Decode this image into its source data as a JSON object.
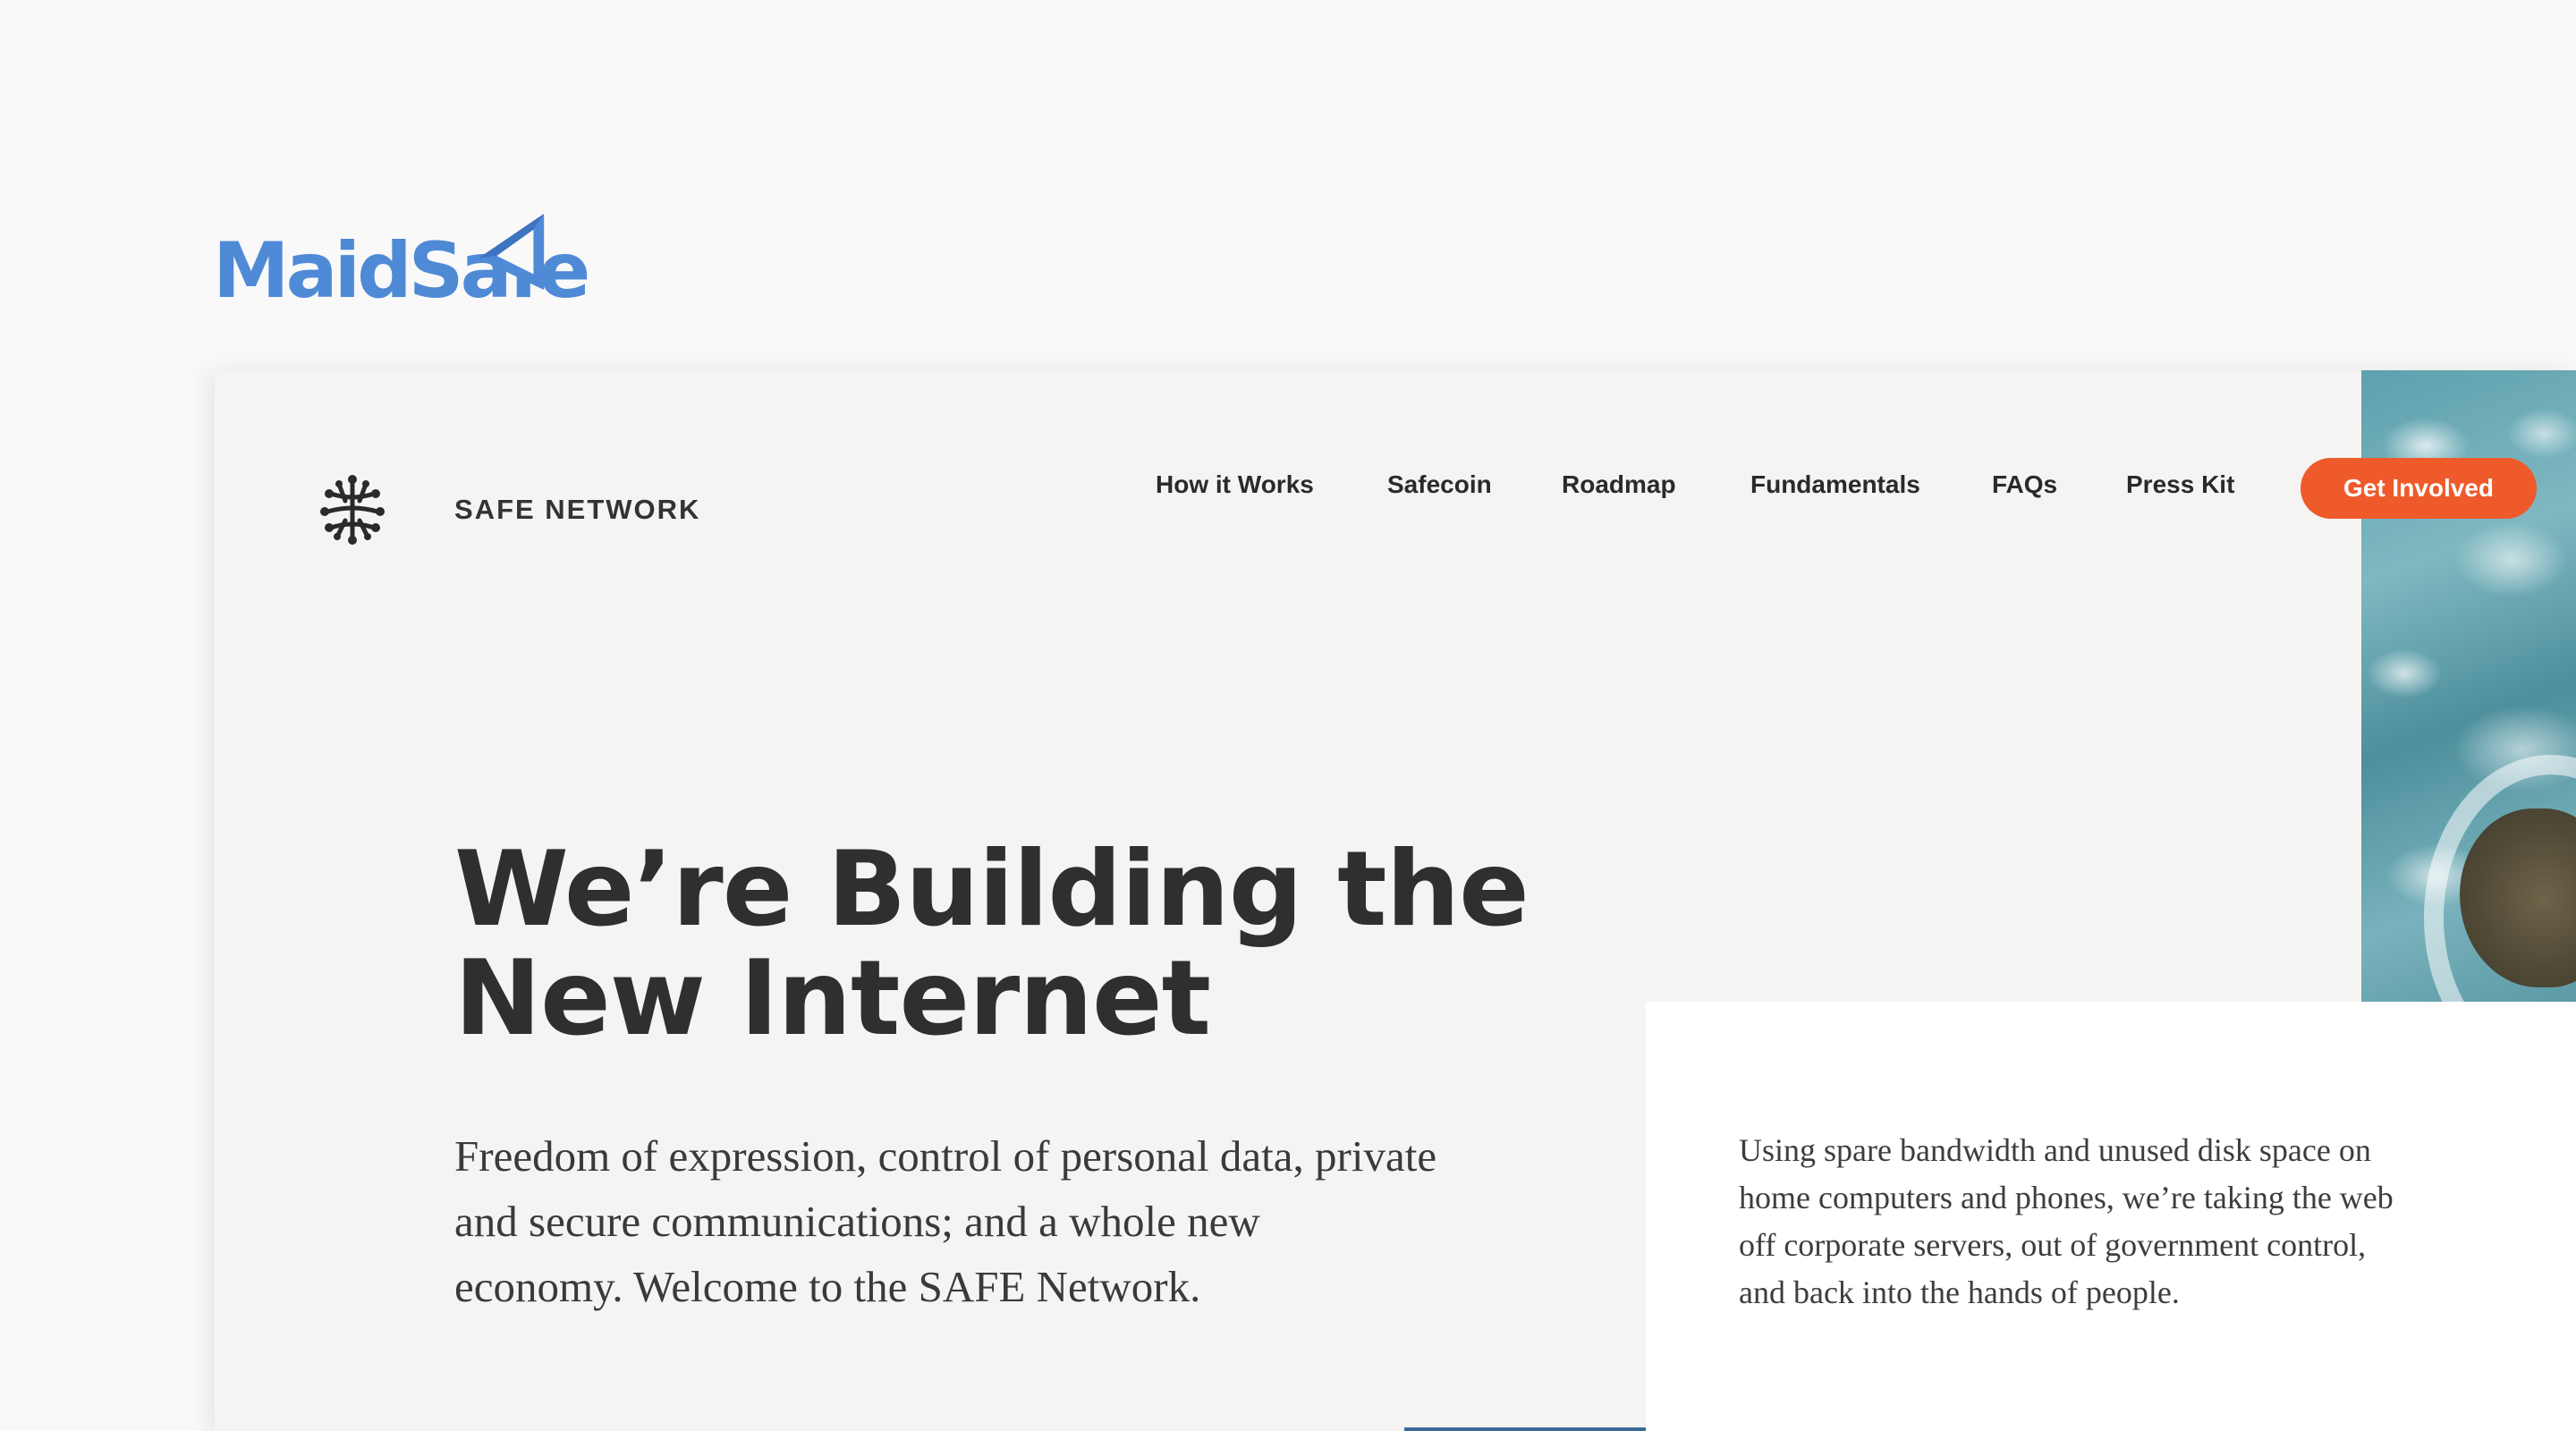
{
  "brand": {
    "name": "MaidSafe",
    "color": "#4f8ad6"
  },
  "site": {
    "logo_text": "SAFE NETWORK",
    "logo_icon": "network-neuron-icon",
    "nav": [
      "How it Works",
      "Safecoin",
      "Roadmap",
      "Fundamentals",
      "FAQs",
      "Press Kit"
    ],
    "cta_label": "Get Involved",
    "accent_color": "#ef5a2a"
  },
  "hero": {
    "title_line1": "We’re Building the",
    "title_line2": "New Internet",
    "subtitle": "Freedom of expression, control of personal data, private and secure communications; and a whole new economy. Welcome to the SAFE Network."
  },
  "panel": {
    "text": "Using spare bandwidth and unused disk space on home computers and phones, we’re taking the web off corporate servers, out of government control, and back into the hands of people."
  }
}
